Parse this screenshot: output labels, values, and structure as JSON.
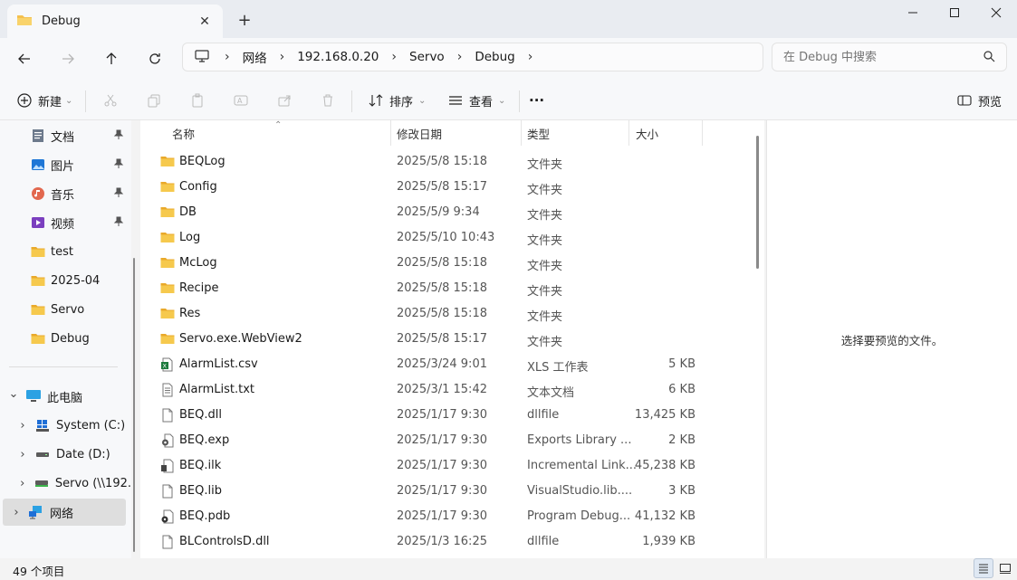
{
  "window": {
    "tab_title": "Debug",
    "new_tab": "+",
    "tab_close": "✕"
  },
  "nav": {
    "breadcrumbs": [
      "网络",
      "192.168.0.20",
      "Servo",
      "Debug"
    ],
    "search_placeholder": "在 Debug 中搜索"
  },
  "commands": {
    "new_label": "新建",
    "sort_label": "排序",
    "view_label": "查看",
    "more_label": "···",
    "preview_label": "预览"
  },
  "sidebar": {
    "quick_access": [
      {
        "label": "文档",
        "icon": "document-icon",
        "pinned": true
      },
      {
        "label": "图片",
        "icon": "pictures-icon",
        "pinned": true
      },
      {
        "label": "音乐",
        "icon": "music-icon",
        "pinned": true
      },
      {
        "label": "视频",
        "icon": "video-icon",
        "pinned": true
      },
      {
        "label": "test",
        "icon": "folder-icon",
        "pinned": false
      },
      {
        "label": "2025-04",
        "icon": "folder-icon",
        "pinned": false
      },
      {
        "label": "Servo",
        "icon": "folder-icon",
        "pinned": false
      },
      {
        "label": "Debug",
        "icon": "folder-icon",
        "pinned": false
      }
    ],
    "this_pc": "此电脑",
    "drives": [
      {
        "label": "System (C:)",
        "icon": "windows-drive-icon"
      },
      {
        "label": "Date (D:)",
        "icon": "drive-icon"
      },
      {
        "label": "Servo (\\\\192.",
        "icon": "network-drive-icon"
      }
    ],
    "network": "网络"
  },
  "file_list": {
    "columns": [
      "名称",
      "修改日期",
      "类型",
      "大小"
    ],
    "rows": [
      {
        "name": "BEQLog",
        "date": "2025/5/8 15:18",
        "type": "文件夹",
        "size": "",
        "icon": "folder-icon"
      },
      {
        "name": "Config",
        "date": "2025/5/8 15:17",
        "type": "文件夹",
        "size": "",
        "icon": "folder-icon"
      },
      {
        "name": "DB",
        "date": "2025/5/9 9:34",
        "type": "文件夹",
        "size": "",
        "icon": "folder-icon"
      },
      {
        "name": "Log",
        "date": "2025/5/10 10:43",
        "type": "文件夹",
        "size": "",
        "icon": "folder-icon"
      },
      {
        "name": "McLog",
        "date": "2025/5/8 15:18",
        "type": "文件夹",
        "size": "",
        "icon": "folder-icon"
      },
      {
        "name": "Recipe",
        "date": "2025/5/8 15:18",
        "type": "文件夹",
        "size": "",
        "icon": "folder-icon"
      },
      {
        "name": "Res",
        "date": "2025/5/8 15:18",
        "type": "文件夹",
        "size": "",
        "icon": "folder-icon"
      },
      {
        "name": "Servo.exe.WebView2",
        "date": "2025/5/8 15:17",
        "type": "文件夹",
        "size": "",
        "icon": "folder-icon"
      },
      {
        "name": "AlarmList.csv",
        "date": "2025/3/24 9:01",
        "type": "XLS 工作表",
        "size": "5 KB",
        "icon": "csv-file-icon"
      },
      {
        "name": "AlarmList.txt",
        "date": "2025/3/1 15:42",
        "type": "文本文档",
        "size": "6 KB",
        "icon": "text-file-icon"
      },
      {
        "name": "BEQ.dll",
        "date": "2025/1/17 9:30",
        "type": "dllfile",
        "size": "13,425 KB",
        "icon": "file-icon"
      },
      {
        "name": "BEQ.exp",
        "date": "2025/1/17 9:30",
        "type": "Exports Library ...",
        "size": "2 KB",
        "icon": "gear-file-icon"
      },
      {
        "name": "BEQ.ilk",
        "date": "2025/1/17 9:30",
        "type": "Incremental Link...",
        "size": "45,238 KB",
        "icon": "link-file-icon"
      },
      {
        "name": "BEQ.lib",
        "date": "2025/1/17 9:30",
        "type": "VisualStudio.lib....",
        "size": "3 KB",
        "icon": "file-icon"
      },
      {
        "name": "BEQ.pdb",
        "date": "2025/1/17 9:30",
        "type": "Program Debug...",
        "size": "41,132 KB",
        "icon": "debug-file-icon"
      },
      {
        "name": "BLControlsD.dll",
        "date": "2025/1/3 16:25",
        "type": "dllfile",
        "size": "1,939 KB",
        "icon": "file-icon"
      }
    ]
  },
  "preview": {
    "empty_text": "选择要预览的文件。"
  },
  "status": {
    "item_count": "49 个项目"
  },
  "colors": {
    "folder": "#f4c04e",
    "accent": "#0067c0"
  }
}
